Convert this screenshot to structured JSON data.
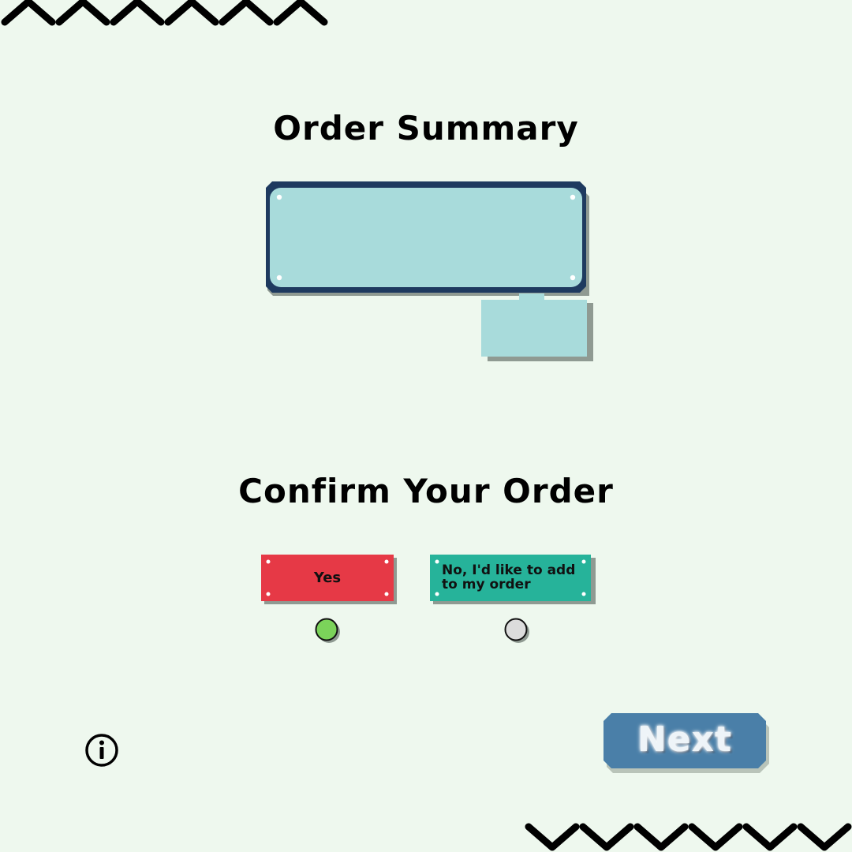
{
  "headings": {
    "order_summary": "Order Summary",
    "confirm_order": "Confirm Your Order"
  },
  "options": {
    "yes_label": "Yes",
    "no_label": "No, I'd like to add to my order",
    "selected": "yes"
  },
  "next_button": {
    "label": "Next"
  },
  "icons": {
    "info": "info-icon",
    "top_decoration": "zigzag-up-icon",
    "bottom_decoration": "zigzag-down-icon"
  },
  "colors": {
    "background": "#eef8ee",
    "panel_fill": "#a8dbdb",
    "panel_border": "#1e3a5f",
    "yes_button": "#e63946",
    "no_button": "#26b39a",
    "radio_selected": "#7bd35a",
    "radio_unselected": "#dcdcdc",
    "next_button": "#4a7fa8"
  }
}
